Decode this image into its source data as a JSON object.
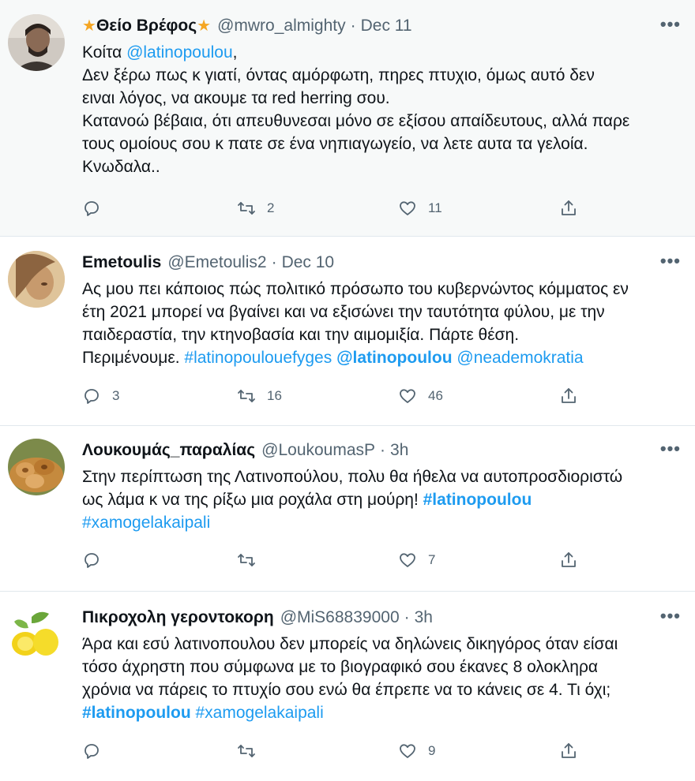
{
  "tweets": [
    {
      "name": "Θείο Βρέφος",
      "name_emoji": "★",
      "handle": "@mwro_almighty",
      "sep": "·",
      "time": "Dec 11",
      "more": "•••",
      "line1_prefix": "Κοίτα ",
      "line1_link": "@latinopoulou",
      "line1_suffix": ",",
      "line2": "Δεν ξέρω πως κ γιατί, όντας αμόρφωτη, πηρες πτυχιο, όμως αυτό δεν",
      "line3": "ειναι λόγος, να ακουμε τα red herring σου.",
      "line4": "Κατανοώ βέβαια, ότι απευθυνεσαι μόνο σε εξίσου απαίδευτους, αλλά παρε",
      "line5": "τους ομοίους σου κ πατε σε ένα νηπιαγωγείο, να λετε αυτα τα γελοία.",
      "line6": "Κνωδαλα..",
      "replies": "",
      "retweets": "2",
      "likes": "11"
    },
    {
      "name": "Emetoulis",
      "handle": "@Emetoulis2",
      "sep": "·",
      "time": "Dec 10",
      "more": "•••",
      "line1": "Ας μου πει κάποιος πώς πολιτικό πρόσωπο του κυβερνώντος κόμματος εν",
      "line2": "έτη 2021 μπορεί να βγαίνει και να εξισώνει την ταυτότητα φύλου, με την",
      "line3": "παιδεραστία, την κτηνοβασία και την αιμομιξία. Πάρτε θέση.",
      "line4_prefix": "Περιμένουμε. ",
      "tag1": "#latinopoulouefyges",
      "mention1": "@latinopoulou",
      "mention2": "@neademokratia",
      "replies": "3",
      "retweets": "16",
      "likes": "46"
    },
    {
      "name": "Λουκουμάς_παραλίας",
      "handle": "@LoukoumasP",
      "sep": "·",
      "time": "3h",
      "more": "•••",
      "line1": "Στην περίπτωση της Λατινοπούλου, πολυ θα ήθελα να αυτοπροσδιοριστώ",
      "line2_prefix": "ως λάμα κ να της ρίξω μια ροχάλα στη μούρη! ",
      "tag1": "#latinopoulou",
      "tag2": "#xamogelakaipali",
      "replies": "",
      "retweets": "",
      "likes": "7"
    },
    {
      "name": "Πικροχολη γεροντοκορη",
      "handle": "@MiS68839000",
      "sep": "·",
      "time": "3h",
      "more": "•••",
      "line1": "Άρα και εσύ λατινοπουλου δεν μπορείς να δηλώνεις δικηγόρος όταν είσαι",
      "line2": "τόσο άχρηστη που σύμφωνα με το βιογραφικό σου έκανες 8 ολοκληρα",
      "line3": "χρόνια  να πάρεις το πτυχίο σου ενώ θα έπρεπε να το κάνεις σε 4. Τι όχι;",
      "tag1": "#latinopoulou",
      "tag2": "#xamogelakaipali",
      "replies": "",
      "retweets": "",
      "likes": "9"
    }
  ],
  "colors": {
    "link": "#1d9bf0",
    "meta": "#536471",
    "highlight_bg": "#f7f9f9",
    "divider": "#e1e8ed"
  },
  "icons": [
    "reply-icon",
    "retweet-icon",
    "like-icon",
    "share-icon",
    "more-icon"
  ]
}
